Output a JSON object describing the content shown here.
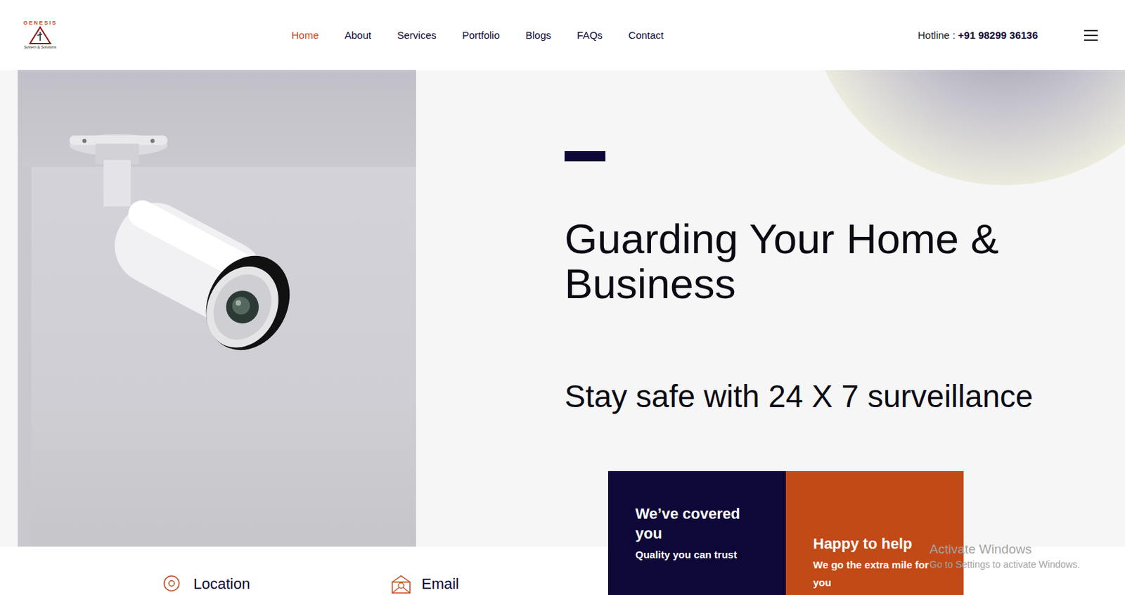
{
  "logo": {
    "name": "GENESIS",
    "tagline": "System & Solutions"
  },
  "nav": [
    {
      "label": "Home",
      "selected": true
    },
    {
      "label": "About",
      "selected": false
    },
    {
      "label": "Services",
      "selected": false
    },
    {
      "label": "Portfolio",
      "selected": false
    },
    {
      "label": "Blogs",
      "selected": false
    },
    {
      "label": "FAQs",
      "selected": false
    },
    {
      "label": "Contact",
      "selected": false
    }
  ],
  "hotline": {
    "label": "Hotline :",
    "number": "+91 98299 36136"
  },
  "hero": {
    "title": "Guarding Your Home & Business",
    "subtitle": "Stay safe with 24 X 7 surveillance"
  },
  "cards": [
    {
      "title": "We’ve covered you",
      "text": "Quality you can trust",
      "color": "#0e0838"
    },
    {
      "title": "Happy to help",
      "text": "We go the extra mile for you",
      "color": "#c24a17"
    }
  ],
  "contacts": [
    {
      "label": "Location"
    },
    {
      "label": "Email"
    }
  ],
  "watermark": {
    "title": "Activate Windows",
    "text": "Go to Settings to activate Windows."
  }
}
